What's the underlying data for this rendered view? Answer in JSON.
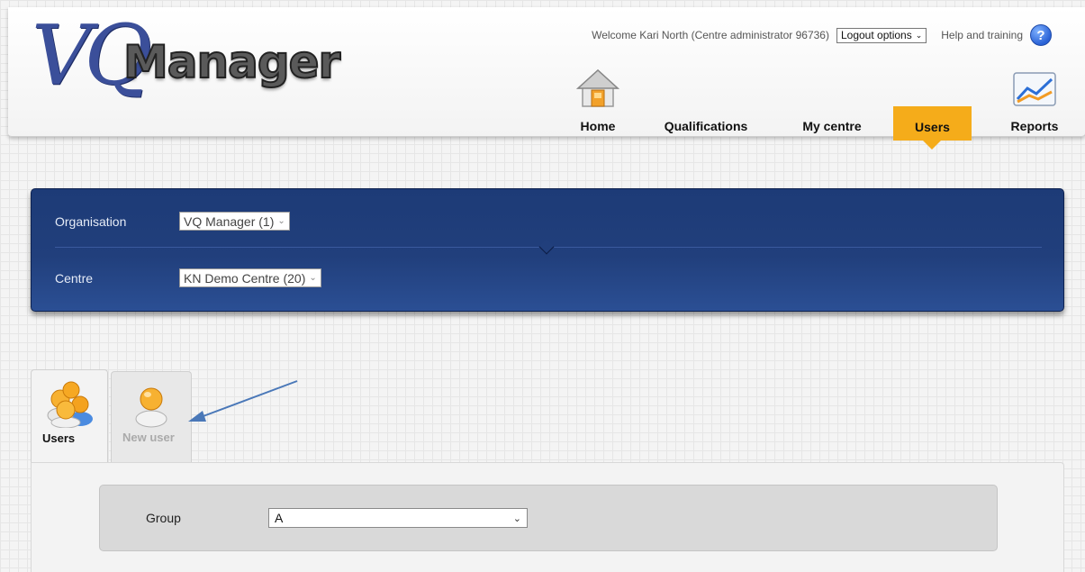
{
  "app": {
    "logo_text_vq": "VQ",
    "logo_text_manager": "Manager"
  },
  "header": {
    "welcome": "Welcome Kari North (Centre administrator 96736)",
    "logout_select": "Logout options",
    "help": "Help and training",
    "help_icon": "?"
  },
  "nav": {
    "items": [
      {
        "label": "Home",
        "icon": "home-icon"
      },
      {
        "label": "Qualifications"
      },
      {
        "label": "My centre"
      },
      {
        "label": "Users",
        "active": true
      },
      {
        "label": "Reports",
        "icon": "reports-icon"
      }
    ],
    "active_color": "#f5ac1a"
  },
  "selector_panel": {
    "organisation_label": "Organisation",
    "organisation_value": "VQ Manager (1)",
    "centre_label": "Centre",
    "centre_value": "KN Demo Centre (20)",
    "panel_color": "#213f7c"
  },
  "tabs": [
    {
      "label": "Users",
      "icon": "users-group-icon",
      "selected": true
    },
    {
      "label": "New user",
      "icon": "new-user-icon",
      "selected": false
    }
  ],
  "content": {
    "group_label": "Group",
    "group_value": "A"
  },
  "annotation": {
    "arrow_color": "#4a78b8"
  },
  "chevron": "⌄"
}
